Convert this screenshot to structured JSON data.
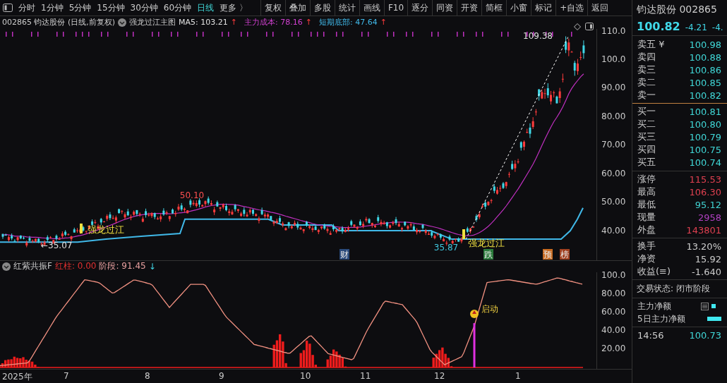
{
  "toolbar": {
    "periods": [
      {
        "label": "分时",
        "selected": false
      },
      {
        "label": "1分钟",
        "selected": false
      },
      {
        "label": "5分钟",
        "selected": false
      },
      {
        "label": "15分钟",
        "selected": false
      },
      {
        "label": "30分钟",
        "selected": false
      },
      {
        "label": "60分钟",
        "selected": false
      },
      {
        "label": "日线",
        "selected": true
      },
      {
        "label": "更多 〉",
        "selected": false
      }
    ],
    "buttons": [
      "复权",
      "叠加",
      "多股",
      "统计",
      "画线",
      "F10",
      "逐分",
      "同资",
      "开资",
      "简框",
      "小窗",
      "标记",
      "+自选",
      "返回"
    ]
  },
  "info_line": {
    "symbol": "002865 钧达股份 (日线,前复权)",
    "template": "强龙过江主图",
    "indicators": [
      {
        "label": "MA5: 103.21",
        "arrow": "↑",
        "color": "#e0e0e0"
      },
      {
        "label": "主力成本: 78.16",
        "arrow": "↑",
        "color": "#d040d0"
      },
      {
        "label": "短期底部: 47.64",
        "arrow": "↑",
        "color": "#40b8e8"
      }
    ]
  },
  "main_chart": {
    "y_ticks": [
      "110.0",
      "100.0",
      "90.00",
      "80.00",
      "70.00",
      "60.00",
      "50.00",
      "40.00"
    ],
    "annotations": [
      {
        "text": "109.38",
        "kind": "price",
        "color": "#e0e0e0"
      },
      {
        "text": "50.10",
        "kind": "price",
        "color": "#ff5050"
      },
      {
        "text": "←35.07",
        "kind": "price",
        "color": "#e0e0e0"
      },
      {
        "text": "35.87",
        "kind": "price",
        "color": "#40c8e0"
      },
      {
        "text": "强龙过江",
        "kind": "signal",
        "color": "#f0e040"
      },
      {
        "text": "强龙过江",
        "kind": "signal",
        "color": "#f0e040"
      },
      {
        "text": "财",
        "kind": "badge",
        "color": "#2a4a7a"
      },
      {
        "text": "跌",
        "kind": "badge",
        "color": "#2a7a3a"
      },
      {
        "text": "预",
        "kind": "badge",
        "color": "#c86a20"
      },
      {
        "text": "榜",
        "kind": "badge",
        "color": "#a04020"
      }
    ]
  },
  "indicator": {
    "name": "红紫共振F",
    "values": [
      {
        "label": "红柱: 0.00",
        "color": "#e03030"
      },
      {
        "label": "阶段: 91.45",
        "color": "#e8a0a0"
      }
    ],
    "arrow": "↓",
    "y_ticks": [
      "100.0",
      "80.00",
      "60.00",
      "40.00",
      "20.00"
    ],
    "signal": "启动"
  },
  "x_axis": [
    "2025年",
    "7",
    "8",
    "9",
    "10",
    "11",
    "12",
    "1"
  ],
  "quote": {
    "title": "钧达股份 002865",
    "price": "100.82",
    "change": "-4.21",
    "change_pct": "-4.",
    "order_book": [
      {
        "label": "卖五 ¥",
        "price": "100.98"
      },
      {
        "label": "卖四",
        "price": "100.88"
      },
      {
        "label": "卖三",
        "price": "100.86"
      },
      {
        "label": "卖二",
        "price": "100.85"
      },
      {
        "label": "卖一",
        "price": "100.82"
      },
      {
        "label": "买一",
        "price": "100.81"
      },
      {
        "label": "买二",
        "price": "100.80"
      },
      {
        "label": "买三",
        "price": "100.79"
      },
      {
        "label": "买四",
        "price": "100.75"
      },
      {
        "label": "买五",
        "price": "100.74"
      }
    ],
    "stats": [
      {
        "label": "涨停",
        "value": "115.53",
        "color": "#e04050"
      },
      {
        "label": "最高",
        "value": "106.30",
        "color": "#e04050"
      },
      {
        "label": "最低",
        "value": "95.12",
        "color": "#40d0d0"
      },
      {
        "label": "现量",
        "value": "2958",
        "color": "#b040c0"
      },
      {
        "label": "外盘",
        "value": "143801",
        "color": "#e04050"
      }
    ],
    "details": [
      {
        "label": "换手",
        "value": "13.20%"
      },
      {
        "label": "净资",
        "value": "15.92"
      },
      {
        "label": "收益(≡)",
        "value": "-1.640"
      }
    ],
    "status": "交易状态: 闭市阶段",
    "flows": [
      {
        "label": "主力净额",
        "kind": "dot"
      },
      {
        "label": "5日主力净额",
        "kind": "bar"
      }
    ],
    "tick": {
      "time": "14:56",
      "price": "100.73"
    }
  }
}
